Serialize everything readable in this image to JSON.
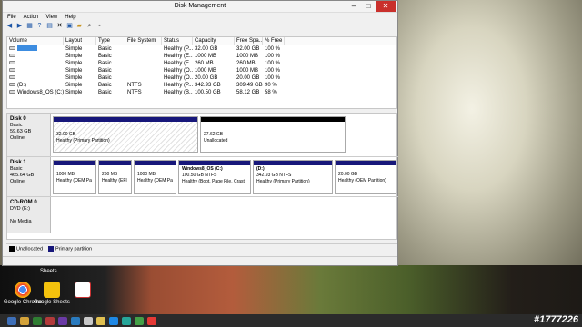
{
  "window": {
    "title": "Disk Management"
  },
  "menu": [
    "File",
    "Action",
    "View",
    "Help"
  ],
  "volume_table": {
    "headers": [
      "Volume",
      "Layout",
      "Type",
      "File System",
      "Status",
      "Capacity",
      "Free Spa...",
      "% Free"
    ],
    "rows": [
      {
        "volume": "",
        "layout": "Simple",
        "type": "Basic",
        "fs": "",
        "status": "Healthy (P...",
        "capacity": "32.00 GB",
        "free": "32.00 GB",
        "pct": "100 %"
      },
      {
        "volume": "",
        "layout": "Simple",
        "type": "Basic",
        "fs": "",
        "status": "Healthy (E...",
        "capacity": "1000 MB",
        "free": "1000 MB",
        "pct": "100 %"
      },
      {
        "volume": "",
        "layout": "Simple",
        "type": "Basic",
        "fs": "",
        "status": "Healthy (E...",
        "capacity": "260 MB",
        "free": "260 MB",
        "pct": "100 %"
      },
      {
        "volume": "",
        "layout": "Simple",
        "type": "Basic",
        "fs": "",
        "status": "Healthy (O...",
        "capacity": "1000 MB",
        "free": "1000 MB",
        "pct": "100 %"
      },
      {
        "volume": "",
        "layout": "Simple",
        "type": "Basic",
        "fs": "",
        "status": "Healthy (O...",
        "capacity": "20.00 GB",
        "free": "20.00 GB",
        "pct": "100 %"
      },
      {
        "volume": "(D:)",
        "layout": "Simple",
        "type": "Basic",
        "fs": "NTFS",
        "status": "Healthy (P...",
        "capacity": "342.93 GB",
        "free": "309.49 GB",
        "pct": "90 %"
      },
      {
        "volume": "Windows8_OS (C:)",
        "layout": "Simple",
        "type": "Basic",
        "fs": "NTFS",
        "status": "Healthy (B...",
        "capacity": "100.50 GB",
        "free": "58.12 GB",
        "pct": "58 %"
      }
    ]
  },
  "disks": [
    {
      "name": "Disk 0",
      "type": "Basic",
      "size": "59.63 GB",
      "state": "Online",
      "parts": [
        {
          "line1": "32.00 GB",
          "line2": "Healthy (Primary Partition)",
          "kind": "primary-selected"
        },
        {
          "line1": "27.62 GB",
          "line2": "Unallocated",
          "kind": "unallocated"
        }
      ]
    },
    {
      "name": "Disk 1",
      "type": "Basic",
      "size": "465.64 GB",
      "state": "Online",
      "parts": [
        {
          "title": "",
          "line1": "1000 MB",
          "line2": "Healthy (OEM Pa",
          "kind": "primary"
        },
        {
          "title": "",
          "line1": "260 MB",
          "line2": "Healthy (EFI",
          "kind": "primary"
        },
        {
          "title": "",
          "line1": "1000 MB",
          "line2": "Healthy (OEM Pa",
          "kind": "primary"
        },
        {
          "title": "Windows8_OS (C:)",
          "line1": "100.50 GB NTFS",
          "line2": "Healthy (Boot, Page File, Crast",
          "kind": "primary"
        },
        {
          "title": "(D:)",
          "line1": "342.93 GB NTFS",
          "line2": "Healthy (Primary Partition)",
          "kind": "primary"
        },
        {
          "title": "",
          "line1": "20.00 GB",
          "line2": "Healthy (OEM Partition)",
          "kind": "primary"
        }
      ]
    },
    {
      "name": "CD-ROM 0",
      "type": "DVD (E:)",
      "size": "",
      "state": "No Media",
      "parts": []
    }
  ],
  "legend": {
    "unallocated": "Unallocated",
    "primary": "Primary partition"
  },
  "desktop": {
    "sheets_label": "Sheets",
    "icons": [
      "Google Chrome",
      "Google Sheets",
      ""
    ]
  },
  "watermark": "#1777226",
  "colors": {
    "primary": "#17177a",
    "unallocated": "#000000",
    "selection": "#3c8ce0"
  }
}
